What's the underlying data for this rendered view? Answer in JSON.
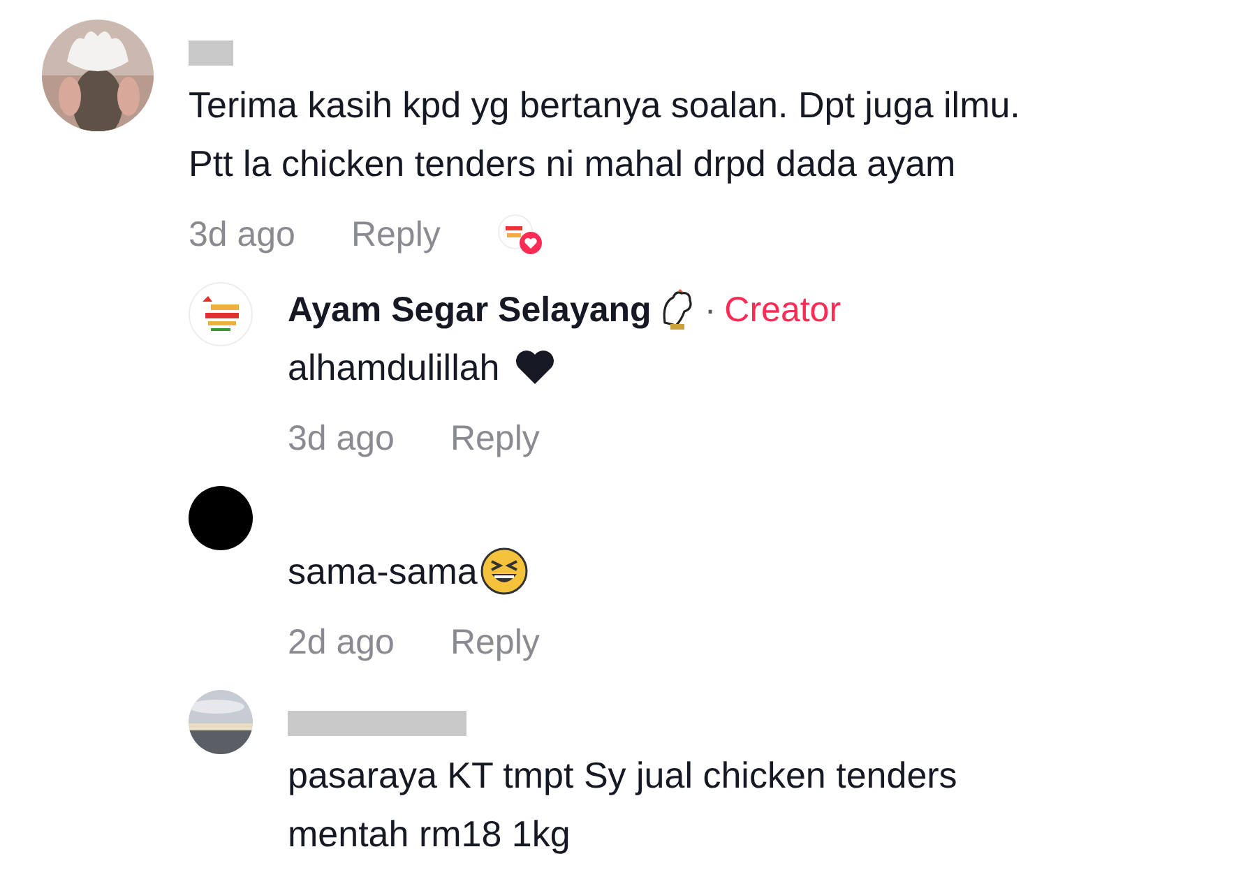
{
  "comments": [
    {
      "avatar": {
        "kind": "paw"
      },
      "author_hidden": true,
      "lines": [
        "Terima kasih kpd yg bertanya soalan. Dpt juga ilmu.",
        "Ptt la chicken tenders ni mahal drpd dada ayam"
      ],
      "time": "3d ago",
      "reply": "Reply",
      "liked_by_creator": true,
      "replies": [
        {
          "avatar": {
            "kind": "logo"
          },
          "author": "Ayam Segar Selayang",
          "badge": {
            "kind": "rooster"
          },
          "separator": "·",
          "role": "Creator",
          "lines": [
            "alhamdulillah"
          ],
          "emoji": {
            "kind": "heart"
          },
          "time": "3d ago",
          "reply": "Reply"
        },
        {
          "avatar": {
            "kind": "plain"
          },
          "lines": [
            "sama-sama"
          ],
          "emoji": {
            "kind": "laugh"
          },
          "time": "2d ago",
          "reply": "Reply"
        },
        {
          "avatar": {
            "kind": "sky"
          },
          "author_hidden": true,
          "lines": [
            "pasaraya KT tmpt Sy jual chicken tenders",
            "mentah rm18 1kg"
          ]
        }
      ]
    }
  ]
}
